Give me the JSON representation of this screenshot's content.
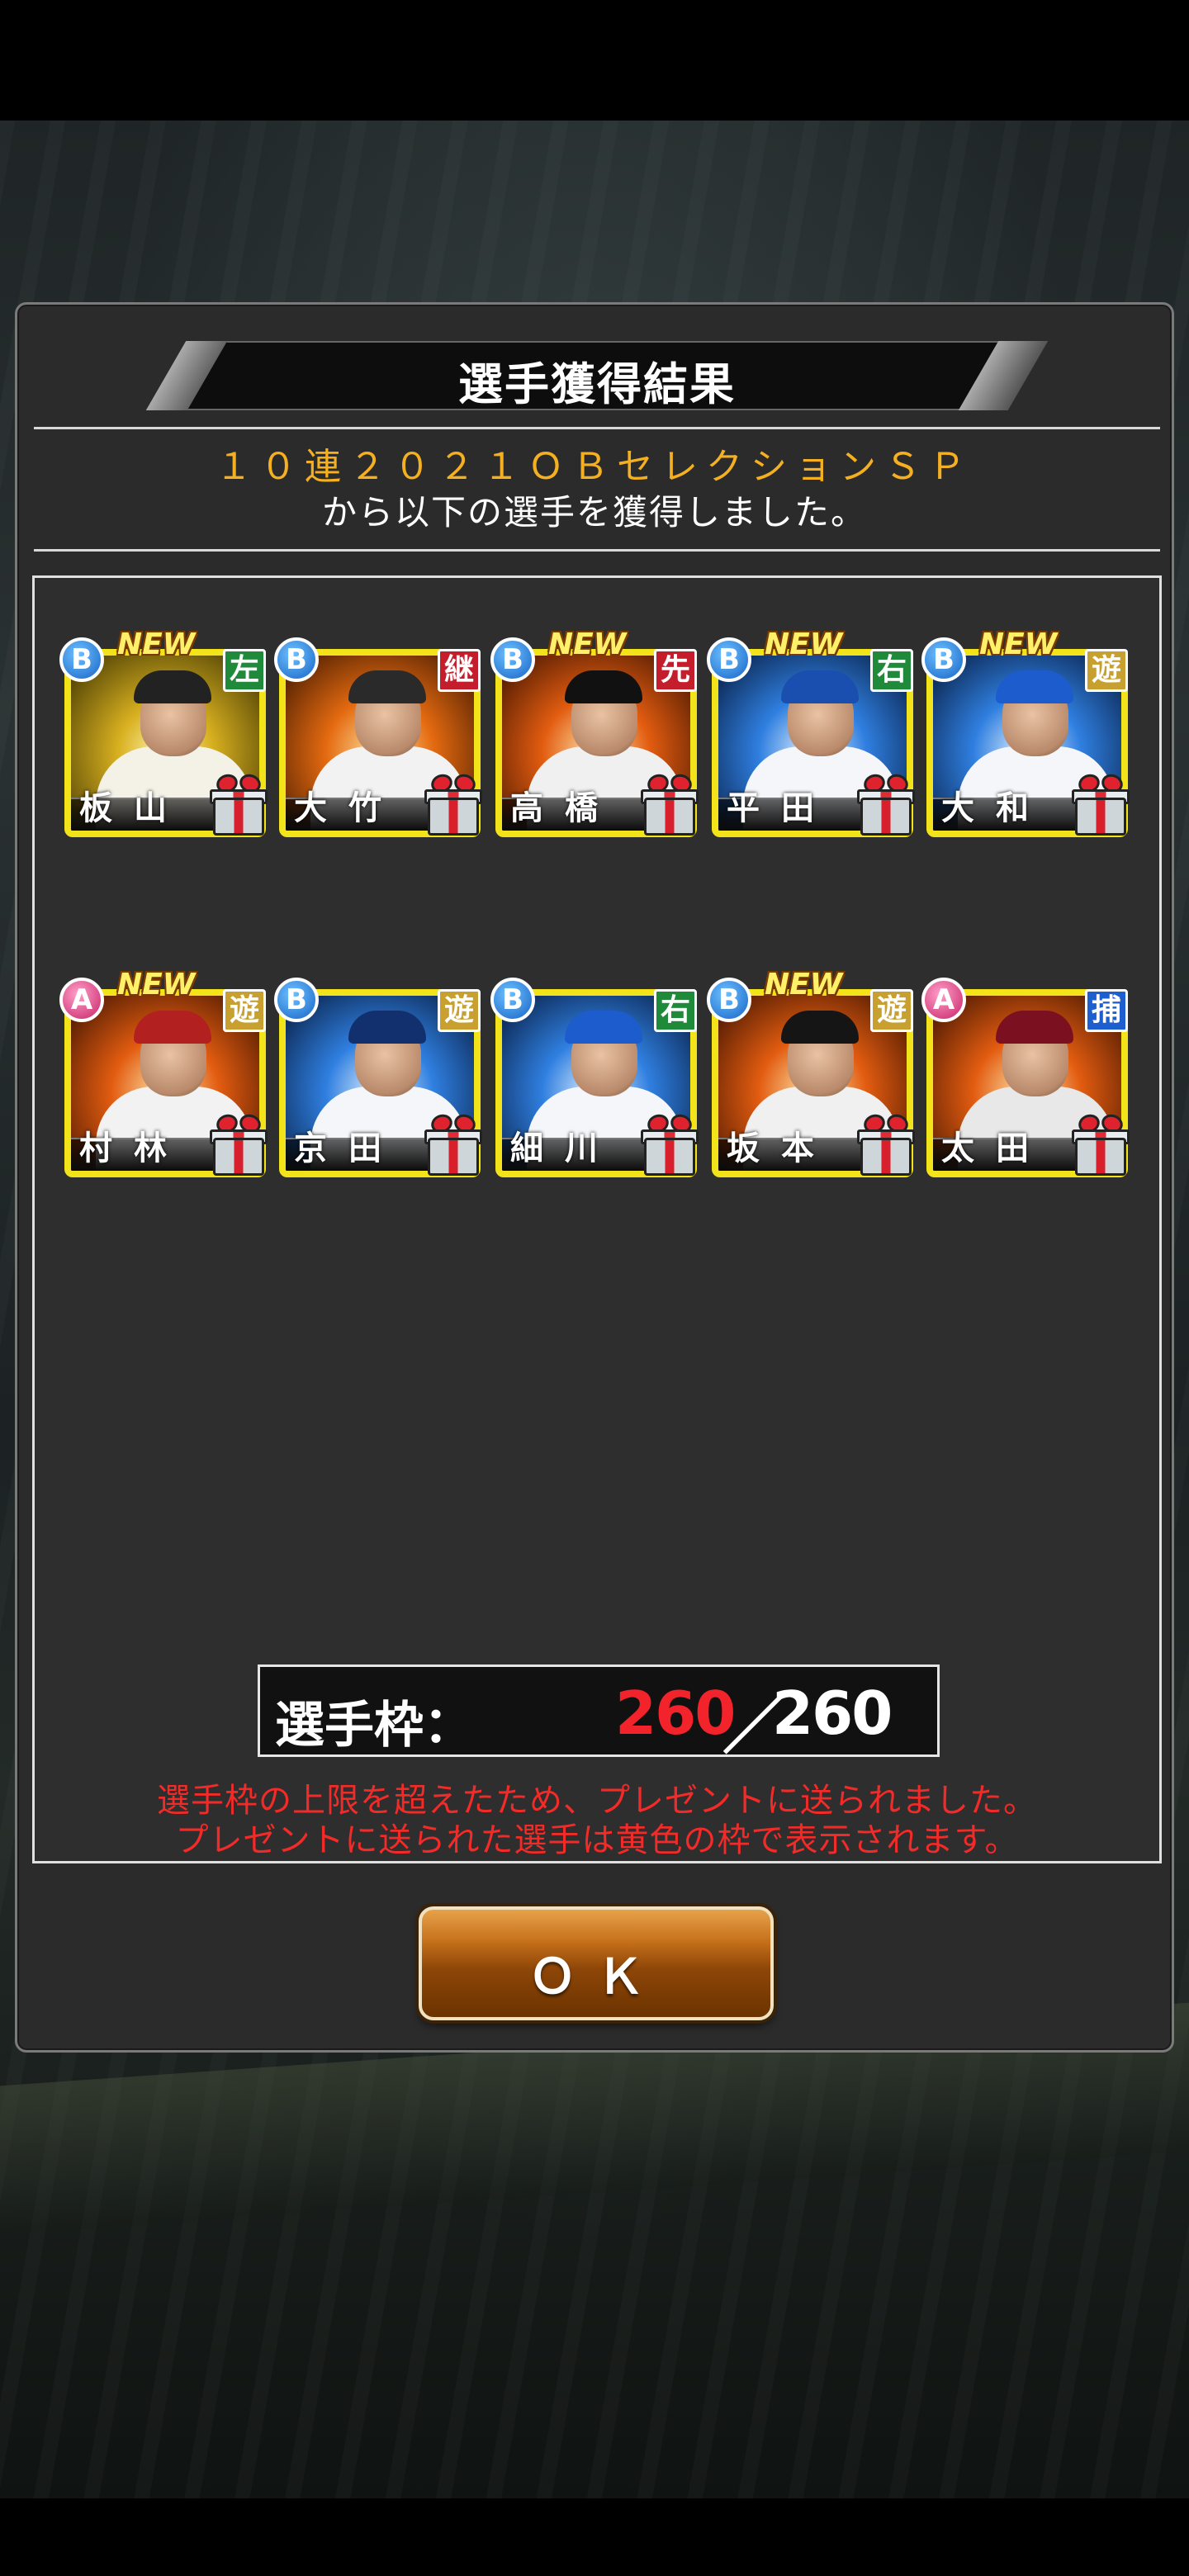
{
  "dialog": {
    "title": "選手獲得結果",
    "gacha_name": "１０連２０２１ＯＢセレクションＳＰ",
    "gacha_sub": "から以下の選手を獲得しました。"
  },
  "players": [
    {
      "name": "板山",
      "rank": "B",
      "position": "左",
      "is_new": true,
      "new_label": "NEW"
    },
    {
      "name": "大竹",
      "rank": "B",
      "position": "継",
      "is_new": false,
      "new_label": ""
    },
    {
      "name": "高橋",
      "rank": "B",
      "position": "先",
      "is_new": true,
      "new_label": "NEW"
    },
    {
      "name": "平田",
      "rank": "B",
      "position": "右",
      "is_new": true,
      "new_label": "NEW"
    },
    {
      "name": "大和",
      "rank": "B",
      "position": "遊",
      "is_new": true,
      "new_label": "NEW"
    },
    {
      "name": "村林",
      "rank": "A",
      "position": "遊",
      "is_new": true,
      "new_label": "NEW"
    },
    {
      "name": "京田",
      "rank": "B",
      "position": "遊",
      "is_new": false,
      "new_label": ""
    },
    {
      "name": "細川",
      "rank": "B",
      "position": "右",
      "is_new": false,
      "new_label": ""
    },
    {
      "name": "坂本",
      "rank": "B",
      "position": "遊",
      "is_new": true,
      "new_label": "NEW"
    },
    {
      "name": "太田",
      "rank": "A",
      "position": "捕",
      "is_new": false,
      "new_label": ""
    }
  ],
  "slots": {
    "label": "選手枠：",
    "current": "260",
    "separator": "／",
    "max": "260"
  },
  "notice": {
    "line1": "選手枠の上限を超えたため、プレゼントに送られました。",
    "line2": "プレゼントに送られた選手は黄色の枠で表示されます。"
  },
  "ok_button": {
    "label": "ＯＫ"
  },
  "colors": {
    "gacha_name": "#f5b021",
    "slot_current": "#f3232b",
    "notice": "#f22a28",
    "present_frame": "#f2e31a"
  }
}
